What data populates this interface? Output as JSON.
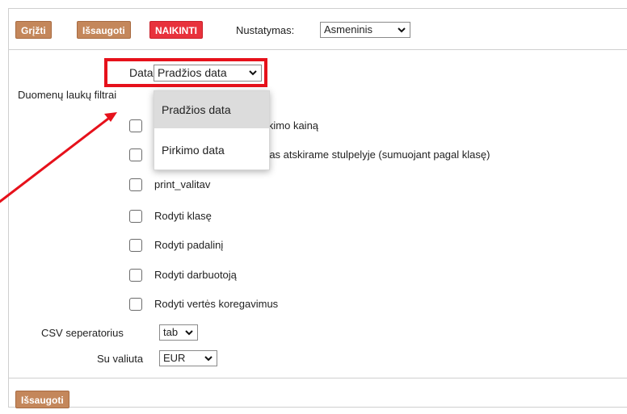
{
  "toolbar": {
    "back_label": "Grįžti",
    "save_label": "Išsaugoti",
    "delete_label": "NAIKINTI",
    "setting_label": "Nustatymas:",
    "setting_value": "Asmeninis"
  },
  "form": {
    "date_label": "Data",
    "date_value": "Pradžios data",
    "filters_label": "Duomenų laukų filtrai",
    "date_options": [
      "Pradžios data",
      "Pirkimo data"
    ],
    "checkboxes": [
      "Netraukia nurašymų į pirkimo kainą",
      "Pirkimo kainą ir nurašymas atskirame stulpelyje (sumuojant pagal klasę)",
      "print_valitav",
      "Rodyti klasę",
      "Rodyti padalinį",
      "Rodyti darbuotoją",
      "Rodyti vertės koregavimus"
    ],
    "csv_label": "CSV seperatorius",
    "csv_value": "tab",
    "currency_label": "Su valiuta",
    "currency_value": "EUR"
  },
  "footer": {
    "save_label": "Išsaugoti"
  },
  "colors": {
    "button_brown": "#c4875b",
    "button_red": "#e8323c",
    "highlight": "#e6111b"
  }
}
